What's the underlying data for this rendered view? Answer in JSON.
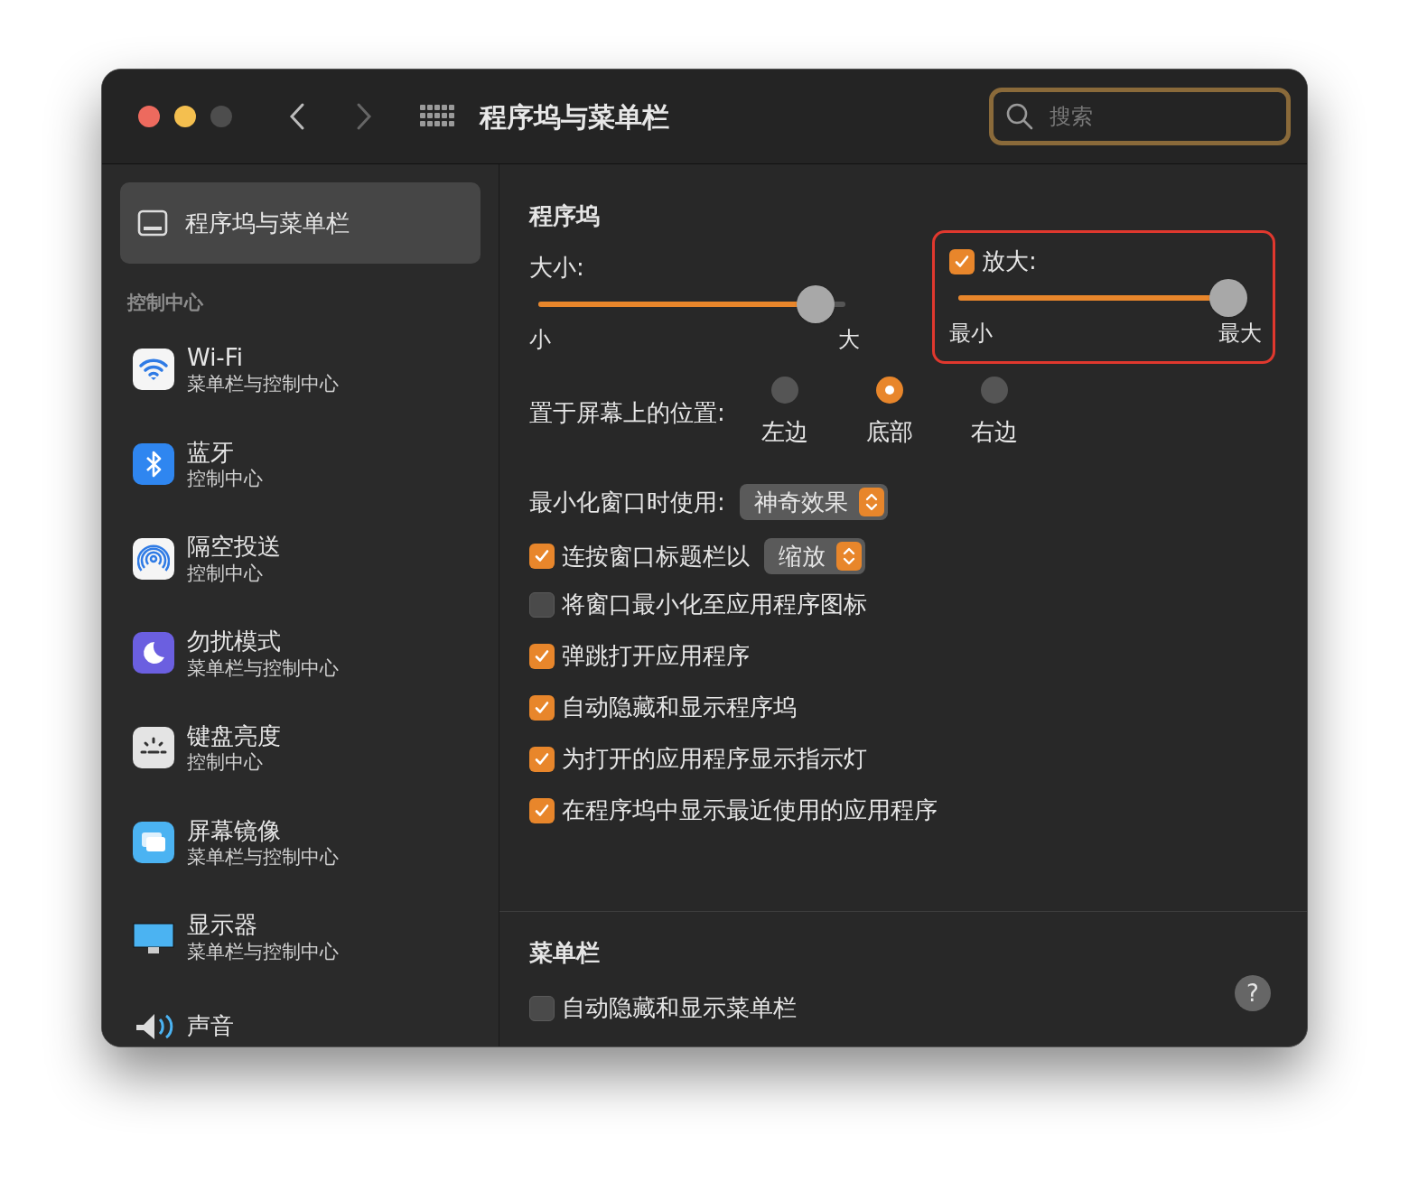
{
  "window": {
    "title": "程序坞与菜单栏"
  },
  "search": {
    "placeholder": "搜索",
    "focused": true
  },
  "sidebar": {
    "selected_item": {
      "label": "程序坞与菜单栏",
      "selected": true
    },
    "section_title": "控制中心",
    "items": [
      {
        "kind": "wifi",
        "title": "Wi-Fi",
        "subtitle": "菜单栏与控制中心"
      },
      {
        "kind": "bluetooth",
        "title": "蓝牙",
        "subtitle": "控制中心"
      },
      {
        "kind": "airdrop",
        "title": "隔空投送",
        "subtitle": "控制中心"
      },
      {
        "kind": "focus",
        "title": "勿扰模式",
        "subtitle": "菜单栏与控制中心"
      },
      {
        "kind": "keyboard",
        "title": "键盘亮度",
        "subtitle": "控制中心"
      },
      {
        "kind": "mirroring",
        "title": "屏幕镜像",
        "subtitle": "菜单栏与控制中心"
      },
      {
        "kind": "display",
        "title": "显示器",
        "subtitle": "菜单栏与控制中心"
      },
      {
        "kind": "sound",
        "title": "声音"
      }
    ]
  },
  "dock": {
    "title": "程序坞",
    "size": {
      "label": "大小:",
      "level": 0.93,
      "min_label": "小",
      "max_label": "大"
    },
    "magnification": {
      "label": "放大:",
      "checked": true,
      "highlighted": true,
      "level": 1,
      "min_label": "最小",
      "max_label": "最大"
    },
    "position": {
      "label": "置于屏幕上的位置:",
      "options": [
        {
          "label": "左边",
          "selected": false
        },
        {
          "label": "底部",
          "selected": true
        },
        {
          "label": "右边",
          "selected": false
        }
      ]
    },
    "minimize_effect": {
      "label": "最小化窗口时使用:",
      "value": "神奇效果"
    },
    "double_click": {
      "label": "连按窗口标题栏以",
      "checked": true,
      "value": "缩放"
    },
    "options": [
      {
        "label": "将窗口最小化至应用程序图标",
        "checked": false
      },
      {
        "label": "弹跳打开应用程序",
        "checked": true
      },
      {
        "label": "自动隐藏和显示程序坞",
        "checked": true
      },
      {
        "label": "为打开的应用程序显示指示灯",
        "checked": true
      },
      {
        "label": "在程序坞中显示最近使用的应用程序",
        "checked": true
      }
    ]
  },
  "menu_bar": {
    "title": "菜单栏",
    "options": [
      {
        "label": "自动隐藏和显示菜单栏",
        "checked": false
      }
    ],
    "help": "?"
  }
}
